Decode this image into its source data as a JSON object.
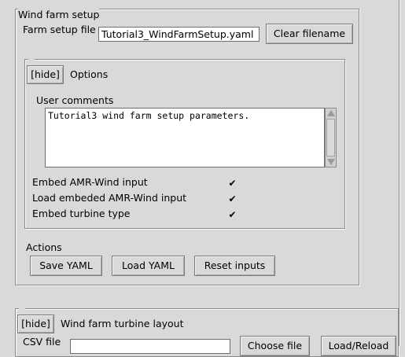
{
  "farm": {
    "title": "Wind farm setup",
    "file_label": "Farm setup file",
    "file_value": "Tutorial3_WindFarmSetup.yaml",
    "clear_label": "Clear filename"
  },
  "options": {
    "hide_label": "[hide]",
    "title": "Options",
    "comments_label": "User comments",
    "comments_value": "Tutorial3 wind farm setup parameters.",
    "checks": [
      {
        "label": "Embed AMR-Wind input",
        "checked": true
      },
      {
        "label": "Load embeded AMR-Wind input",
        "checked": true
      },
      {
        "label": "Embed turbine type",
        "checked": true
      }
    ]
  },
  "actions": {
    "title": "Actions",
    "save_label": "Save YAML",
    "load_label": "Load YAML",
    "reset_label": "Reset inputs"
  },
  "layout": {
    "hide_label": "[hide]",
    "title": "Wind farm turbine layout",
    "csv_label": "CSV file",
    "csv_value": "",
    "choose_label": "Choose file",
    "load_label": "Load/Reload"
  },
  "icons": {
    "check": "check-icon",
    "scroll_up": "triangle-up-icon",
    "scroll_down": "triangle-down-icon"
  }
}
